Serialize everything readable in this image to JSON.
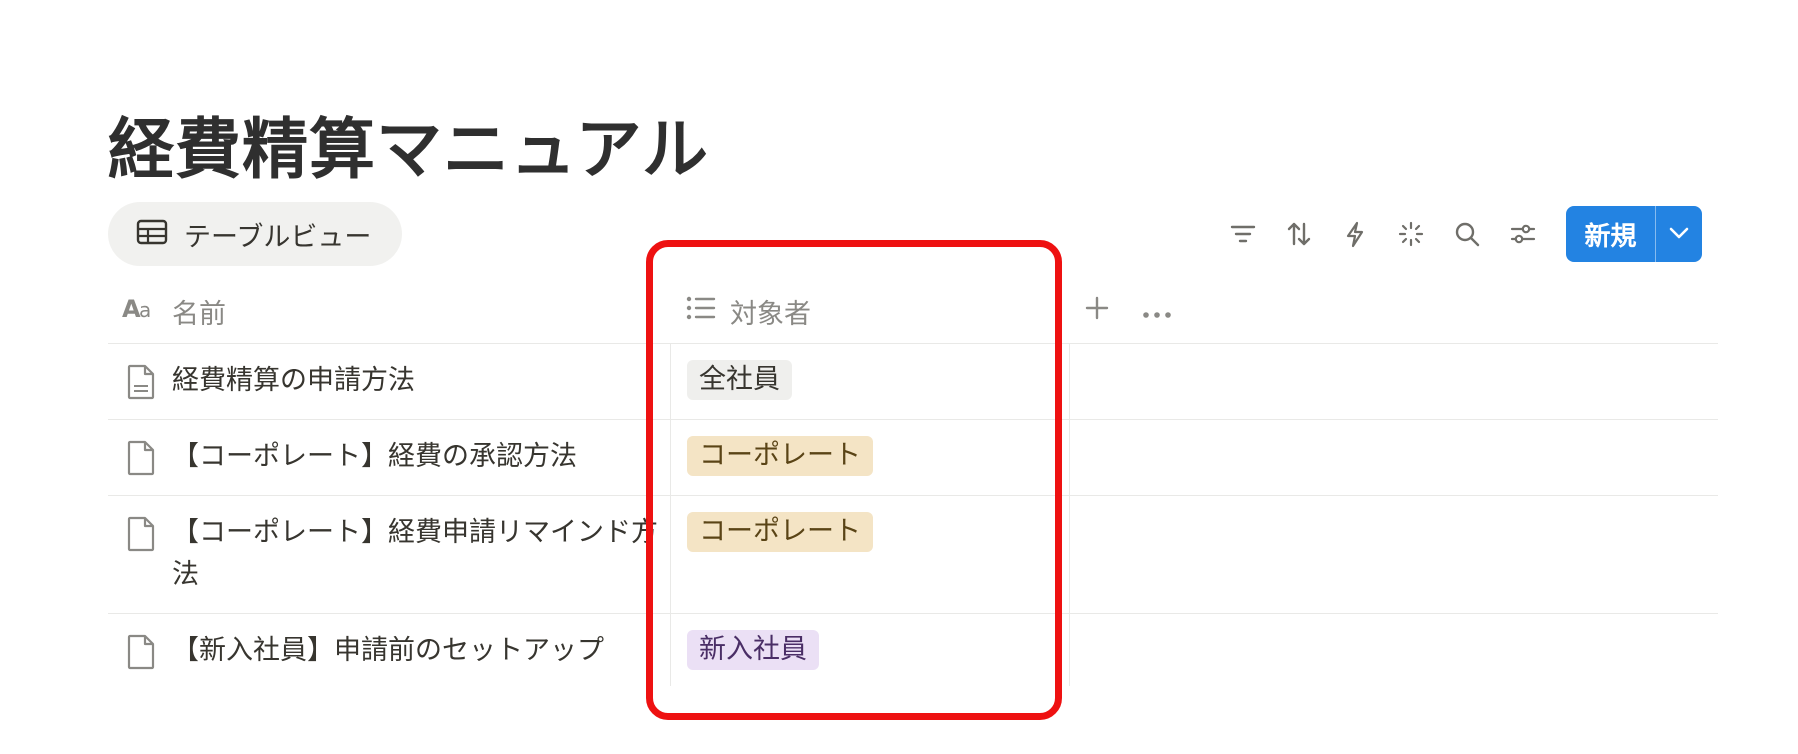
{
  "page": {
    "title": "経費精算マニュアル"
  },
  "view": {
    "tab_label": "テーブルビュー"
  },
  "toolbar": {
    "icons": [
      "filter-icon",
      "sort-icon",
      "automation-icon",
      "ai-sparkle-icon",
      "search-icon",
      "settings-sliders-icon"
    ],
    "new_label": "新規",
    "accent_color": "#2383e2"
  },
  "table": {
    "columns": [
      {
        "icon": "text-type-icon",
        "label": "名前"
      },
      {
        "icon": "list-icon",
        "label": "対象者"
      }
    ],
    "rows": [
      {
        "name": "経費精算の申請方法",
        "tag": "全社員",
        "tag_bg": "#efefed",
        "tag_fg": "#37352f",
        "icon": "page-with-text-icon"
      },
      {
        "name": "【コーポレート】経費の承認方法",
        "tag": "コーポレート",
        "tag_bg": "#f4e4c5",
        "tag_fg": "#5a4416",
        "icon": "blank-page-icon"
      },
      {
        "name": "【コーポレート】経費申請リマインド方法",
        "tag": "コーポレート",
        "tag_bg": "#f4e4c5",
        "tag_fg": "#5a4416",
        "icon": "blank-page-icon"
      },
      {
        "name": "【新入社員】申請前のセットアップ",
        "tag": "新入社員",
        "tag_bg": "#ebe0f5",
        "tag_fg": "#4a2e66",
        "icon": "blank-page-icon"
      }
    ]
  },
  "annotation": {
    "highlight_color": "#ee1111"
  }
}
